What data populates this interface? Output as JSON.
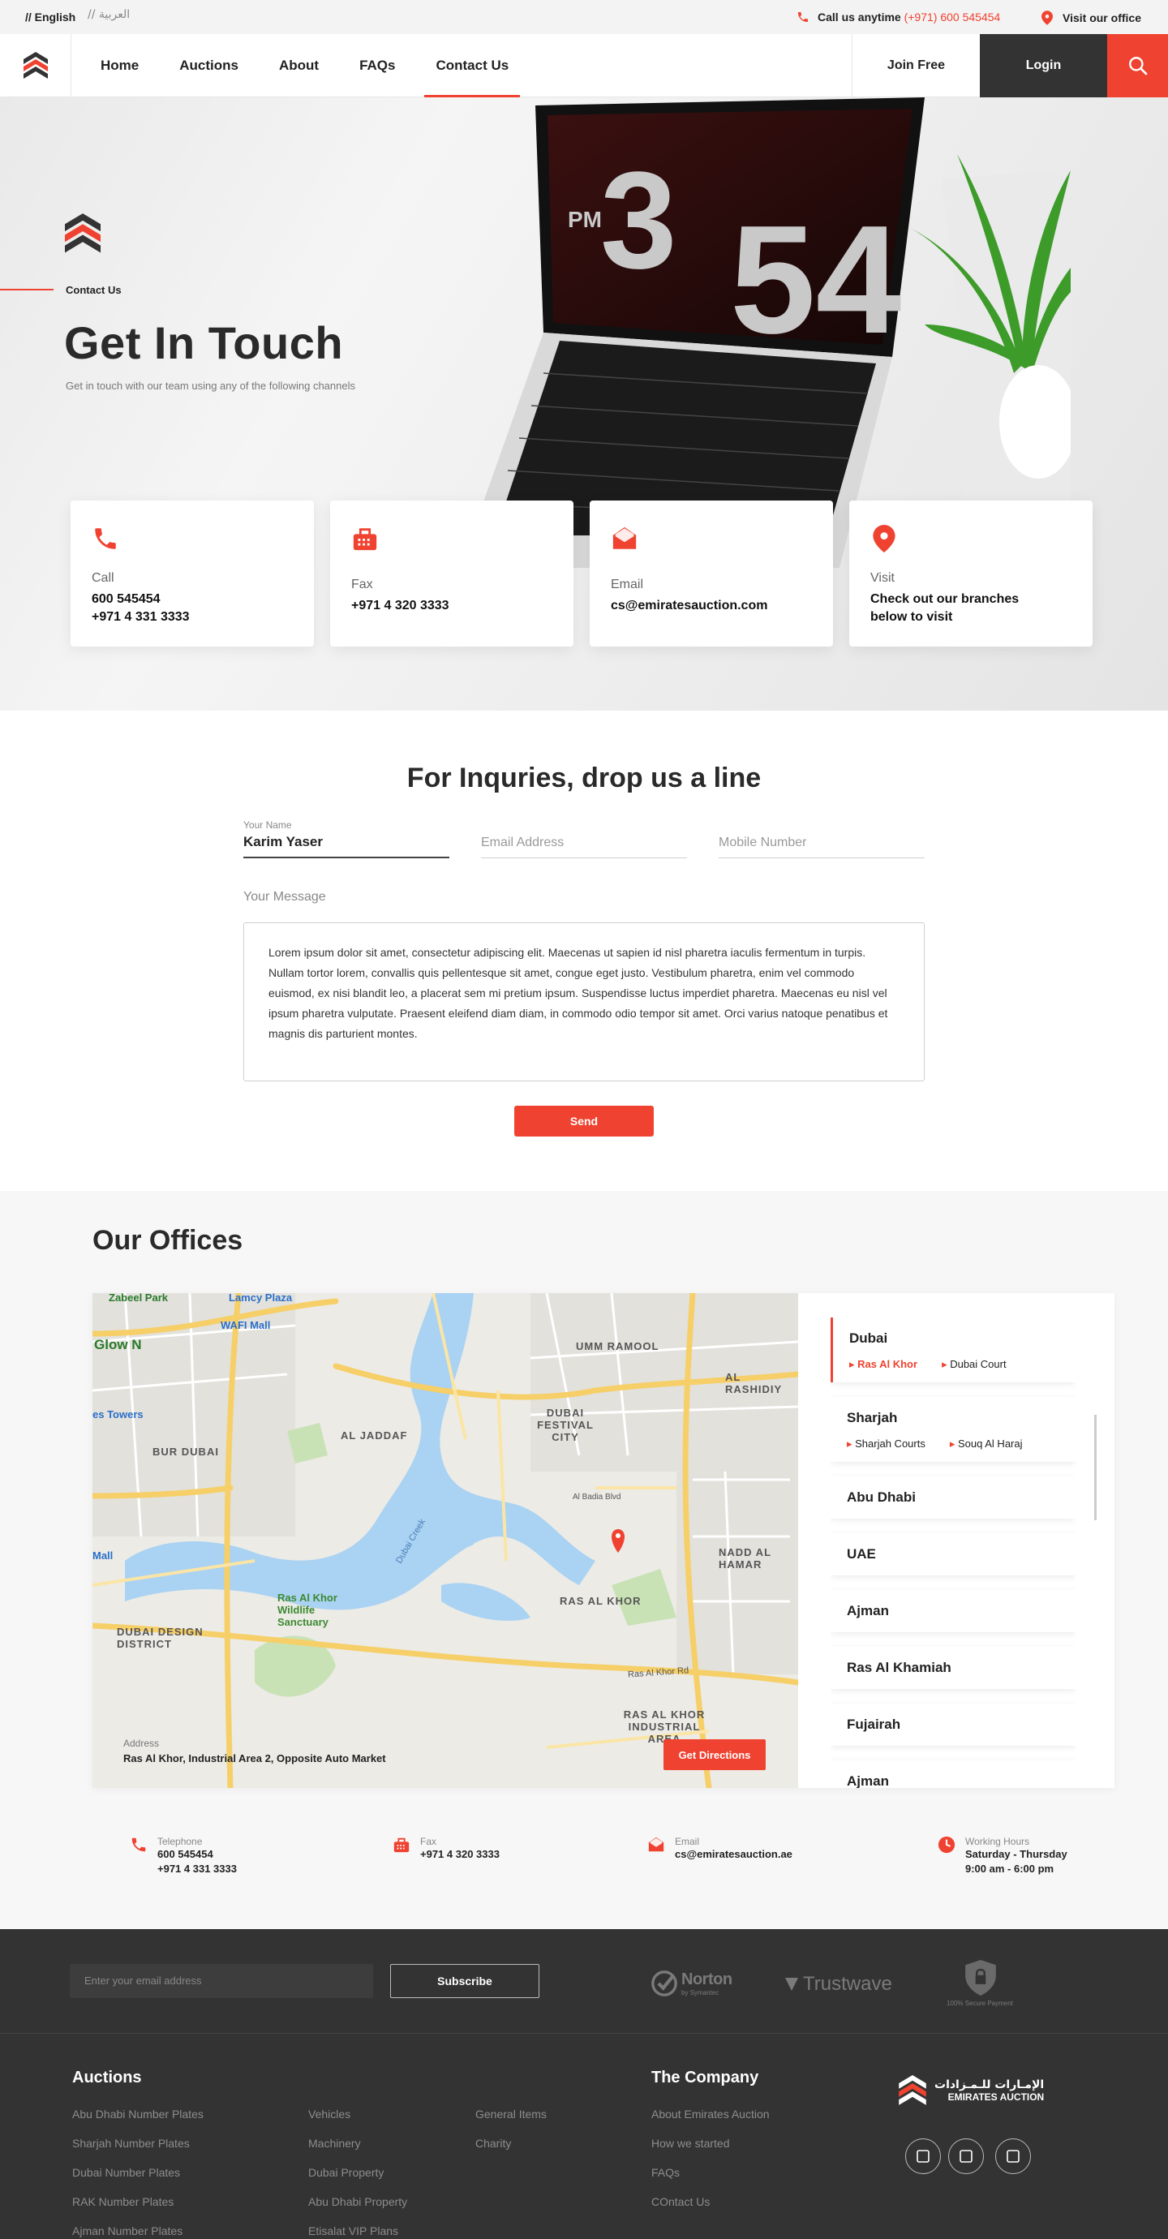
{
  "topbar": {
    "lang_en": "// English",
    "lang_ar": "// العربية",
    "call_label": "Call us anytime",
    "call_number": "(+971) 600 545454",
    "visit": "Visit our office"
  },
  "nav": {
    "items": [
      "Home",
      "Auctions",
      "About",
      "FAQs",
      "Contact Us"
    ],
    "join": "Join Free",
    "login": "Login"
  },
  "hero": {
    "crumb": "Contact Us",
    "title": "Get In Touch",
    "subtitle": "Get in touch with our team using any of the following channels",
    "screen_hour": "3",
    "screen_min": "54",
    "screen_pm": "PM"
  },
  "cards": [
    {
      "label": "Call",
      "lines": [
        "600 545454",
        "+971 4 331 3333"
      ]
    },
    {
      "label": "Fax",
      "lines": [
        "+971 4 320 3333"
      ]
    },
    {
      "label": "Email",
      "lines": [
        "cs@emiratesauction.com"
      ]
    },
    {
      "label": "Visit",
      "lines": [
        "Check out our branches",
        "below to visit"
      ]
    }
  ],
  "form": {
    "title": "For Inquries, drop us a line",
    "name_label": "Your Name",
    "name_value": "Karim Yaser",
    "email_placeholder": "Email Address",
    "mobile_placeholder": "Mobile Number",
    "message_label": "Your Message",
    "message": "Lorem ipsum dolor sit amet, consectetur adipiscing elit. Maecenas ut sapien id nisl pharetra iaculis fermentum in turpis. Nullam tortor lorem, convallis quis pellentesque sit amet, congue eget justo. Vestibulum pharetra, enim vel commodo euismod, ex nisi blandit leo, a placerat sem mi pretium ipsum. Suspendisse luctus imperdiet pharetra. Maecenas eu nisl vel ipsum pharetra vulputate. Praesent eleifend diam diam, in commodo odio tempor sit amet. Orci varius natoque penatibus et magnis dis parturient montes.",
    "send": "Send"
  },
  "offices": {
    "title": "Our Offices",
    "address_label": "Address",
    "address": "Ras Al Khor, Industrial Area 2, Opposite Auto Market",
    "directions": "Get Directions",
    "map_labels": {
      "umm_ramool": "UMM RAMOOL",
      "al_rashidiya": "AL RASHIDIY",
      "al_jaddaf": "AL JADDAF",
      "festival_city": "DUBAI FESTIVAL CITY",
      "bur_dubai": "BUR DUBAI",
      "nadd_al_hamar": "NADD AL HAMAR",
      "ras_al_khor": "RAS AL KHOR",
      "design_district": "DUBAI DESIGN DISTRICT",
      "wildlife": "Ras Al Khor Wildlife Sanctuary",
      "industrial": "RAS AL KHOR INDUSTRIAL AREA",
      "glow": "Glow N",
      "wafi": "WAFI Mall",
      "lamcy": "Lamcy Plaza",
      "zabeel": "Zabeel Park",
      "towers": "es Towers",
      "mall": "Mall",
      "creek": "Dubai Creek",
      "badia": "Al Badia Blvd",
      "khor_rd": "Ras Al Khor Rd"
    },
    "cities": [
      {
        "name": "Dubai",
        "branches": [
          "Ras Al Khor",
          "Dubai Court"
        ]
      },
      {
        "name": "Sharjah",
        "branches": [
          "Sharjah Courts",
          "Souq Al Haraj"
        ]
      },
      {
        "name": "Abu Dhabi",
        "branches": []
      },
      {
        "name": "UAE",
        "branches": []
      },
      {
        "name": "Ajman",
        "branches": []
      },
      {
        "name": "Ras Al Khamiah",
        "branches": []
      },
      {
        "name": "Fujairah",
        "branches": []
      },
      {
        "name": "Ajman",
        "branches": []
      }
    ],
    "contacts": [
      {
        "label": "Telephone",
        "lines": [
          "600 545454",
          "+971 4 331 3333"
        ]
      },
      {
        "label": "Fax",
        "lines": [
          "+971 4 320 3333"
        ]
      },
      {
        "label": "Email",
        "lines": [
          "cs@emiratesauction.ae"
        ]
      },
      {
        "label": "Working Hours",
        "lines": [
          "Saturday - Thursday",
          "9:00 am - 6:00 pm"
        ]
      }
    ]
  },
  "footer": {
    "email_placeholder": "Enter your email address",
    "subscribe": "Subscribe",
    "norton": "Norton",
    "norton_sub": "by Symantec",
    "trustwave": "Trustwave",
    "secure": "100% Secure Payment",
    "auctions_title": "Auctions",
    "auctions_col1": [
      "Abu Dhabi Number Plates",
      "Sharjah Number Plates",
      "Dubai Number Plates",
      "RAK Number Plates",
      "Ajman Number Plates"
    ],
    "auctions_col2": [
      "Vehicles",
      "Machinery",
      "Dubai Property",
      "Abu Dhabi Property",
      "Etisalat VIP Plans"
    ],
    "auctions_col3": [
      "General Items",
      "Charity"
    ],
    "company_title": "The Company",
    "company_links": [
      "About Emirates Auction",
      "How we started",
      "FAQs",
      "COntact Us"
    ],
    "brand_ar": "الإمـارات للـمـزادات",
    "brand_en": "EMIRATES AUCTION"
  },
  "colors": {
    "accent": "#f04230",
    "dark": "#333333"
  }
}
